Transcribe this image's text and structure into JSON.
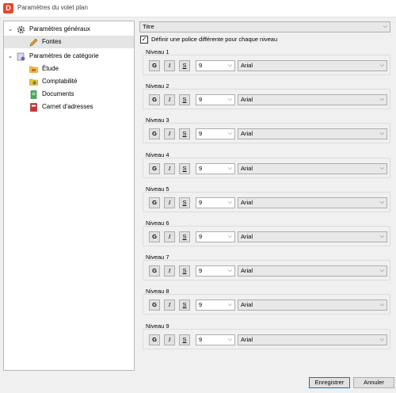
{
  "window": {
    "title": "Paramètres du volet plan",
    "app_icon": "D"
  },
  "tree": {
    "items": [
      {
        "label": "Paramètres généraux",
        "icon": "gear-icon",
        "expander": "⌄"
      },
      {
        "label": "Fontes",
        "icon": "pencil-icon"
      },
      {
        "label": "Paramètres de catégorie",
        "icon": "category-icon",
        "expander": "⌄"
      },
      {
        "label": "Étude",
        "icon": "folder-study-icon"
      },
      {
        "label": "Comptabilité",
        "icon": "folder-accounting-icon"
      },
      {
        "label": "Documents",
        "icon": "document-icon"
      },
      {
        "label": "Carnet d'adresses",
        "icon": "address-book-icon"
      }
    ]
  },
  "style_select": {
    "value": "Titre"
  },
  "per_level_checkbox": {
    "label": "Définir une police différente pour chaque niveau",
    "checked": true
  },
  "format_buttons": {
    "bold": "G",
    "italic": "I",
    "underline": "S"
  },
  "levels": [
    {
      "label": "Niveau 1",
      "size": "9",
      "font": "Arial"
    },
    {
      "label": "Niveau 2",
      "size": "9",
      "font": "Arial"
    },
    {
      "label": "Niveau 3",
      "size": "9",
      "font": "Arial"
    },
    {
      "label": "Niveau 4",
      "size": "9",
      "font": "Arial"
    },
    {
      "label": "Niveau 5",
      "size": "9",
      "font": "Arial"
    },
    {
      "label": "Niveau 6",
      "size": "9",
      "font": "Arial"
    },
    {
      "label": "Niveau 7",
      "size": "9",
      "font": "Arial"
    },
    {
      "label": "Niveau 8",
      "size": "9",
      "font": "Arial"
    },
    {
      "label": "Niveau 9",
      "size": "9",
      "font": "Arial"
    }
  ],
  "footer": {
    "save_label": "Enregistrer",
    "cancel_label": "Annuler"
  },
  "colors": {
    "accent": "#0078d7",
    "app_icon_bg": "#e8462f"
  }
}
